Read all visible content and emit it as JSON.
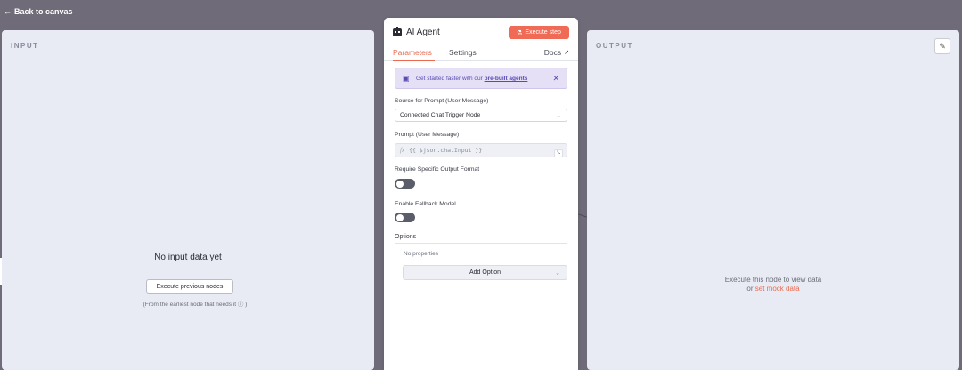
{
  "topbar": {
    "back_label": "Back to canvas"
  },
  "input_panel": {
    "title": "INPUT",
    "empty_title": "No input data yet",
    "execute_previous_label": "Execute previous nodes",
    "earliest_note": "(From the earliest node that needs it ⓘ )"
  },
  "output_panel": {
    "title": "OUTPUT",
    "message_line1": "Execute this node to view data",
    "message_or": "or",
    "mock_link": "set mock data"
  },
  "node": {
    "title": "AI Agent",
    "execute_step_label": "Execute step",
    "tabs": {
      "parameters": "Parameters",
      "settings": "Settings",
      "docs": "Docs"
    },
    "banner": {
      "prefix": "Get started faster with our",
      "link": "pre-built agents"
    },
    "source_label": "Source for Prompt (User Message)",
    "source_value": "Connected Chat Trigger Node",
    "prompt_label": "Prompt (User Message)",
    "prompt_fx": "fx",
    "prompt_value": "{{ $json.chatInput }}",
    "require_format_label": "Require Specific Output Format",
    "require_format_enabled": false,
    "fallback_label": "Enable Fallback Model",
    "fallback_enabled": false,
    "options_label": "Options",
    "no_properties": "No properties",
    "add_option_label": "Add Option"
  },
  "icons": {
    "back": "arrow-left-icon",
    "robot": "robot-icon",
    "flask": "flask-icon",
    "external": "external-link-icon",
    "edit": "pencil-icon",
    "close": "close-icon",
    "chevron": "chevron-down-icon"
  },
  "colors": {
    "accent": "#ea6a4f",
    "execute_button": "#ef6b55",
    "banner_bg": "#e6e0f7",
    "banner_text": "#5a4ab3",
    "panel_bg": "#e8ebf4",
    "canvas_bg": "#6f6b78"
  }
}
